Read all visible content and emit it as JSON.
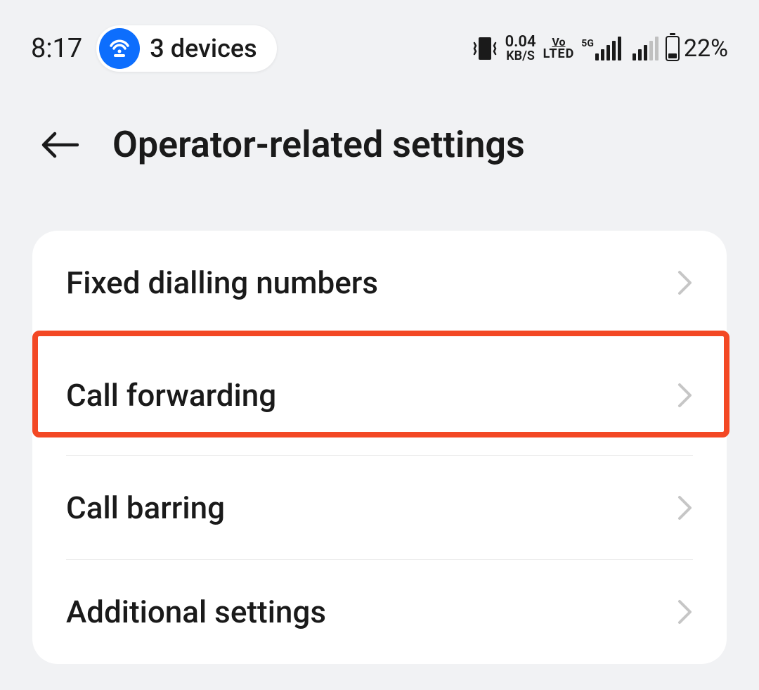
{
  "status": {
    "time": "8:17",
    "hotspot_label": "3 devices",
    "data_speed_value": "0.04",
    "data_speed_unit": "KB/S",
    "volte_top": "Vo",
    "volte_bottom": "LTED",
    "network_label": "5G",
    "battery_percent": "22%"
  },
  "header": {
    "title": "Operator-related settings"
  },
  "settings": {
    "items": [
      {
        "label": "Fixed dialling numbers"
      },
      {
        "label": "Call forwarding"
      },
      {
        "label": "Call barring"
      },
      {
        "label": "Additional settings"
      }
    ]
  },
  "highlight": {
    "index": 1,
    "color": "#f34824"
  }
}
